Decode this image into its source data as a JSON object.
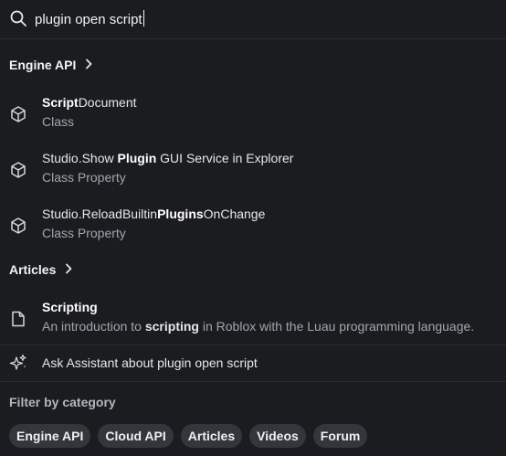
{
  "search": {
    "icon": "search-icon",
    "query": "plugin open script"
  },
  "engine_api": {
    "label": "Engine API",
    "results": [
      {
        "icon": "cube-icon",
        "title_parts": [
          {
            "text": "Script",
            "bold": true
          },
          {
            "text": "Document",
            "bold": false
          }
        ],
        "subtitle": "Class"
      },
      {
        "icon": "cube-icon",
        "title_parts": [
          {
            "text": "Studio.Show ",
            "bold": false
          },
          {
            "text": "Plugin",
            "bold": true
          },
          {
            "text": " GUI Service in Explorer",
            "bold": false
          }
        ],
        "subtitle": "Class Property"
      },
      {
        "icon": "cube-icon",
        "title_parts": [
          {
            "text": "Studio.ReloadBuiltin",
            "bold": false
          },
          {
            "text": "Plugins",
            "bold": true
          },
          {
            "text": "OnChange",
            "bold": false
          }
        ],
        "subtitle": "Class Property"
      }
    ]
  },
  "articles": {
    "label": "Articles",
    "results": [
      {
        "icon": "document-icon",
        "title": "Scripting",
        "subtitle_parts": [
          {
            "text": "An introduction to ",
            "bold": false
          },
          {
            "text": "scripting",
            "bold": true
          },
          {
            "text": " in Roblox with the Luau programming language.",
            "bold": false
          }
        ]
      }
    ]
  },
  "assistant": {
    "icon": "sparkle-icon",
    "label": "Ask Assistant about plugin open script"
  },
  "filter": {
    "title": "Filter by category",
    "chips": [
      "Engine API",
      "Cloud API",
      "Articles",
      "Videos",
      "Forum"
    ]
  }
}
